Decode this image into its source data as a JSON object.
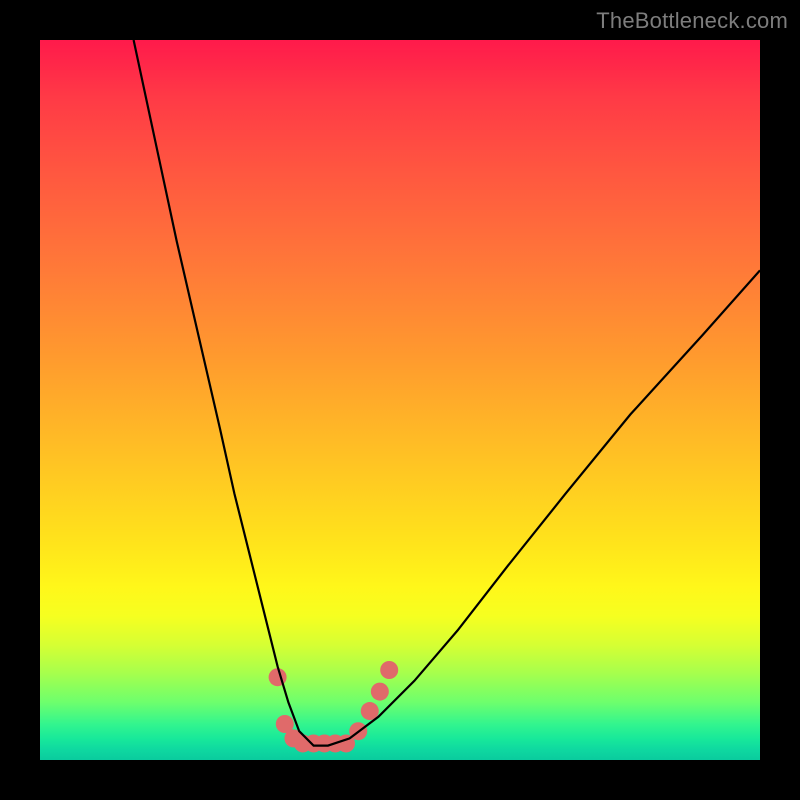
{
  "watermark": "TheBottleneck.com",
  "chart_data": {
    "type": "line",
    "title": "",
    "xlabel": "",
    "ylabel": "",
    "xlim": [
      0,
      100
    ],
    "ylim": [
      0,
      100
    ],
    "grid": false,
    "legend": false,
    "background_gradient": {
      "top": "#ff1a4b",
      "mid": "#ffe41b",
      "bottom": "#0acb9e"
    },
    "series": [
      {
        "name": "bottleneck-curve",
        "color": "#000000",
        "x": [
          13,
          16,
          19,
          22,
          25,
          27,
          29,
          31,
          33,
          34.5,
          36,
          38,
          40,
          43,
          47,
          52,
          58,
          65,
          73,
          82,
          92,
          100
        ],
        "values": [
          100,
          86,
          72,
          59,
          46,
          37,
          29,
          21,
          13,
          8,
          4,
          2,
          2,
          3,
          6,
          11,
          18,
          27,
          37,
          48,
          59,
          68
        ]
      }
    ],
    "markers": {
      "name": "highlight-dots",
      "color": "#e06a6a",
      "radius": 9,
      "points": [
        {
          "x": 33.0,
          "y": 11.5
        },
        {
          "x": 34.0,
          "y": 5.0
        },
        {
          "x": 35.2,
          "y": 3.0
        },
        {
          "x": 36.5,
          "y": 2.3
        },
        {
          "x": 38.0,
          "y": 2.3
        },
        {
          "x": 39.5,
          "y": 2.3
        },
        {
          "x": 41.0,
          "y": 2.3
        },
        {
          "x": 42.5,
          "y": 2.3
        },
        {
          "x": 44.2,
          "y": 4.0
        },
        {
          "x": 45.8,
          "y": 6.8
        },
        {
          "x": 47.2,
          "y": 9.5
        },
        {
          "x": 48.5,
          "y": 12.5
        }
      ]
    }
  }
}
